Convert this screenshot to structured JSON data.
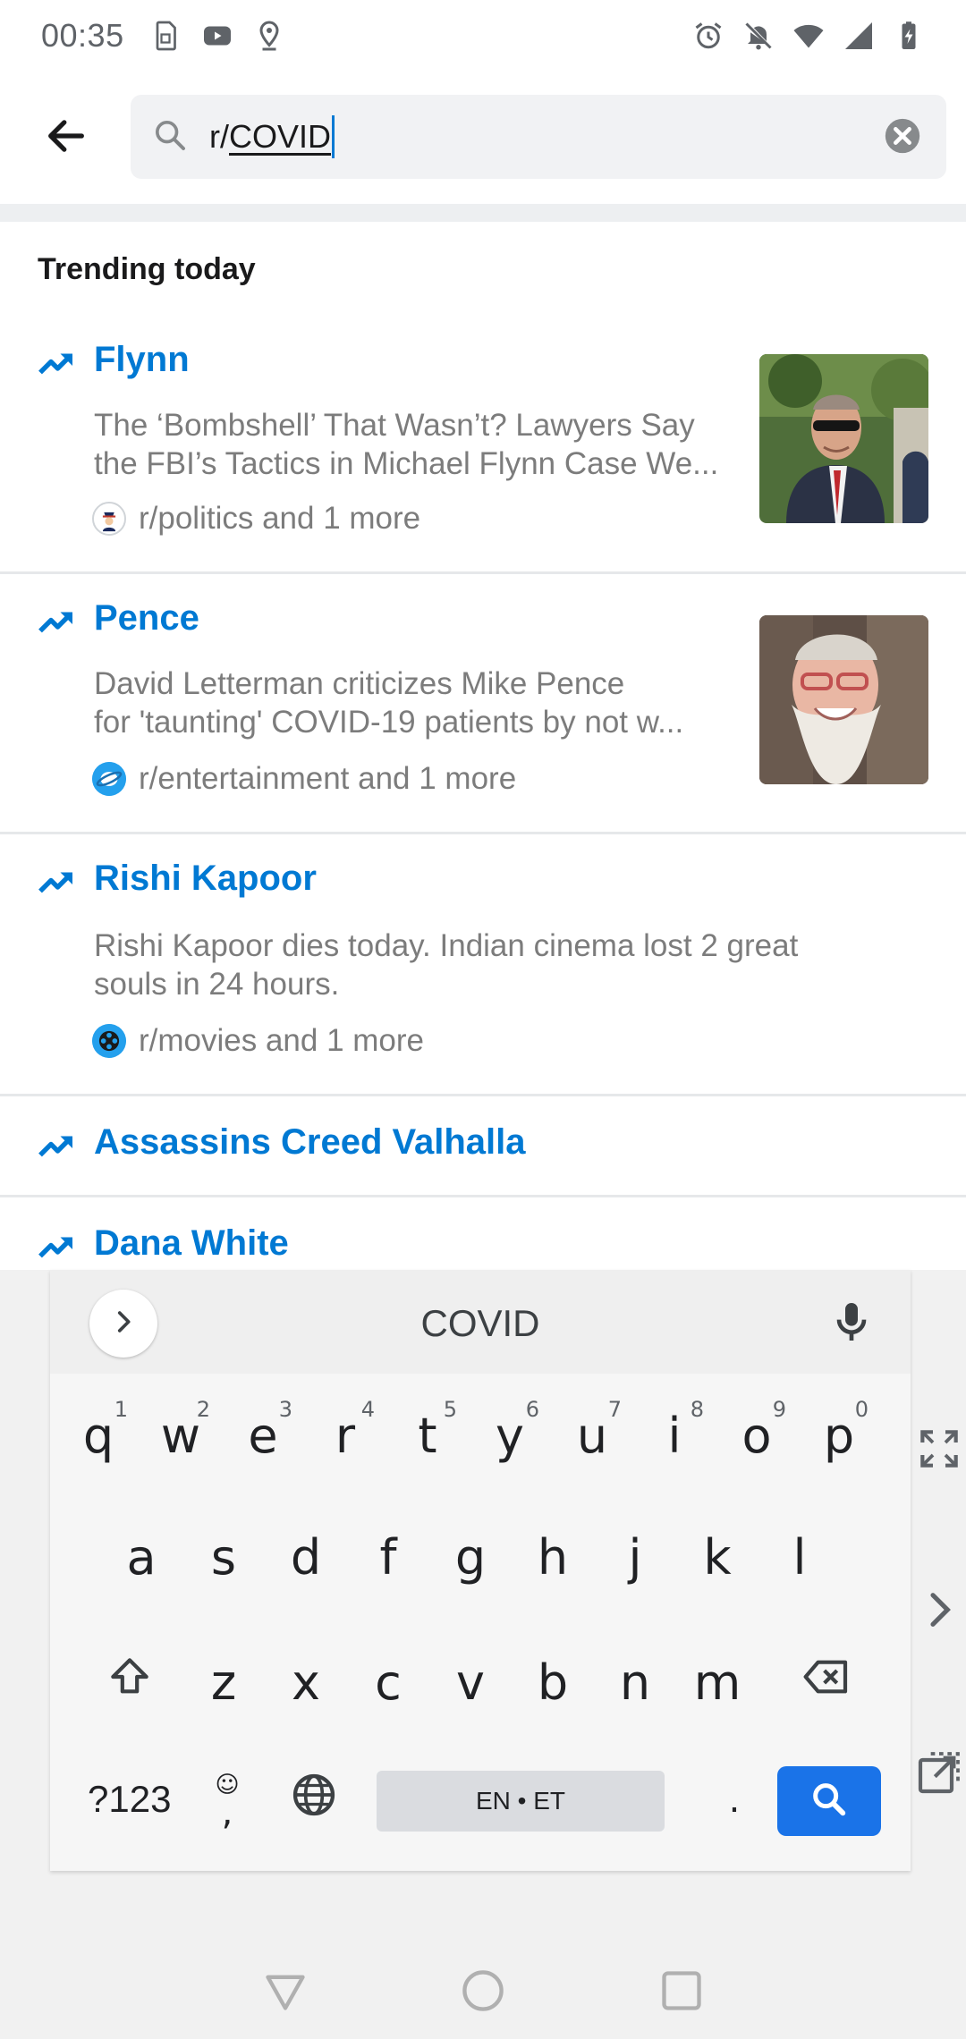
{
  "status_bar": {
    "time": "00:35",
    "left_icons": [
      "sim-card-icon",
      "youtube-icon",
      "location-pin-icon"
    ],
    "right_icons": [
      "alarm-icon",
      "notifications-off-icon",
      "wifi-icon",
      "signal-icon",
      "battery-charging-icon"
    ]
  },
  "search": {
    "prefix": "r/",
    "query": "COVID",
    "clear_icon": "clear-icon",
    "back_icon": "back-arrow-icon"
  },
  "trending": {
    "title": "Trending today",
    "items": [
      {
        "title": "Flynn",
        "desc_line1": "The ‘Bombshell’ That Wasn’t? Lawyers Say",
        "desc_line2": "the FBI’s Tactics in Michael Flynn Case We...",
        "subreddit": "r/politics and 1 more",
        "avatar_icon": "politics-avatar-icon",
        "has_thumb": true
      },
      {
        "title": "Pence",
        "desc_line1": "David Letterman criticizes Mike Pence",
        "desc_line2": "for 'taunting' COVID-19 patients by not w...",
        "subreddit": "r/entertainment and 1 more",
        "avatar_icon": "entertainment-avatar-icon",
        "has_thumb": true
      },
      {
        "title": "Rishi Kapoor",
        "desc_line1": "Rishi Kapoor dies today. Indian cinema lost 2 great",
        "desc_line2": "souls in 24 hours.",
        "subreddit": "r/movies and 1 more",
        "avatar_icon": "movies-avatar-icon",
        "has_thumb": false
      },
      {
        "title": "Assassins Creed Valhalla"
      },
      {
        "title": "Dana White"
      }
    ]
  },
  "keyboard": {
    "suggestion": "COVID",
    "row1": [
      {
        "k": "q",
        "h": "1"
      },
      {
        "k": "w",
        "h": "2"
      },
      {
        "k": "e",
        "h": "3"
      },
      {
        "k": "r",
        "h": "4"
      },
      {
        "k": "t",
        "h": "5"
      },
      {
        "k": "y",
        "h": "6"
      },
      {
        "k": "u",
        "h": "7"
      },
      {
        "k": "i",
        "h": "8"
      },
      {
        "k": "o",
        "h": "9"
      },
      {
        "k": "p",
        "h": "0"
      }
    ],
    "row2": [
      "a",
      "s",
      "d",
      "f",
      "g",
      "h",
      "j",
      "k",
      "l"
    ],
    "row3": [
      "z",
      "x",
      "c",
      "v",
      "b",
      "n",
      "m"
    ],
    "symbols_label": "?123",
    "emoji_comma": ",",
    "period": ".",
    "space_label": "EN • ET",
    "accent_color": "#1a73e8"
  },
  "colors": {
    "link_blue": "#0079d3",
    "muted_text": "#7c7c7c",
    "divider": "#edeff1"
  }
}
